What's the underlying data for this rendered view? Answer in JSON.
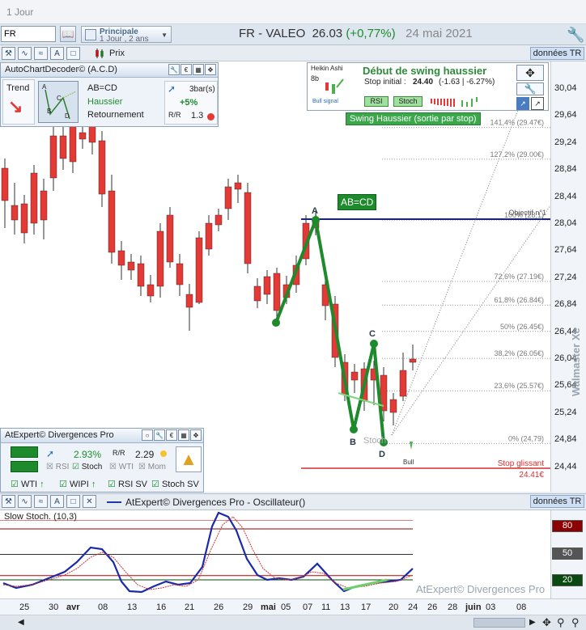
{
  "window": {
    "title": "1 Jour"
  },
  "toolbar": {
    "symbol_value": "FR",
    "layout_name": "Principale",
    "layout_period": "1 Jour , 2 ans",
    "instrument_title": "FR - VALEO",
    "price": "26.03",
    "change": "(+0,77%)",
    "date": "24 mai 2021",
    "prix_label": "Prix",
    "data_source": "données TR"
  },
  "acd": {
    "title": "AutoChartDecoder© (A.C.D)",
    "trend_label": "Trend",
    "pattern": "AB=CD",
    "direction": "Haussier",
    "reversal": "Retournement",
    "bars_count": "3bar(s)",
    "pct": "+5%",
    "ratio": "1.3",
    "mini_labels": [
      "A",
      "C",
      "B",
      "D"
    ]
  },
  "swing": {
    "heikin_label": "Heikin Ashi",
    "heikin_value": "8b",
    "bull_signal": "Bull signal",
    "title": "Début de swing haussier",
    "stop_label": "Stop initial :",
    "stop_value": "24.40",
    "stop_detail": "(-1.63 | -6.27%)",
    "rsi_btn": "RSI",
    "stoch_btn": "Stoch",
    "banner": "Swing Haussier (sortie par stop)"
  },
  "chart_overlay": {
    "abcd_tag": "AB=CD",
    "points": {
      "A": "A",
      "B": "B",
      "C": "C",
      "D": "D"
    },
    "objective_label": "Objectif n°1",
    "stoch_label": "Stoch",
    "bull_label": "Bull",
    "stop_label": "Stop glissant",
    "stop_value": "24.41€"
  },
  "fib_levels": [
    {
      "label": "141,4% (29.47€)",
      "price": 29.47
    },
    {
      "label": "127,2% (29.00€)",
      "price": 29.0
    },
    {
      "label": "100% (28,1)",
      "price": 28.1
    },
    {
      "label": "72,6% (27.19€)",
      "price": 27.19
    },
    {
      "label": "61,8% (26.84€)",
      "price": 26.84
    },
    {
      "label": "50% (26.45€)",
      "price": 26.45
    },
    {
      "label": "38,2% (26.05€)",
      "price": 26.05
    },
    {
      "label": "23,6% (25.57€)",
      "price": 25.57
    },
    {
      "label": "0% (24,79)",
      "price": 24.79
    }
  ],
  "y_axis": [
    "30,04",
    "29,64",
    "29,24",
    "28,84",
    "28,44",
    "28,04",
    "27,64",
    "27,24",
    "26,84",
    "26,44",
    "26,04",
    "25,64",
    "25,24",
    "24,84",
    "24,44"
  ],
  "divergences": {
    "title": "AtExpert© Divergences Pro",
    "val1": "2.93%",
    "val2": "2.29",
    "chk_rsi": "RSI",
    "chk_stoch": "Stoch",
    "chk_wti": "WTI",
    "chk_mom": "Mom",
    "chk_wti2": "WTI",
    "chk_wipi": "WIPI",
    "chk_rsisv": "RSI SV",
    "chk_stochsv": "Stoch SV"
  },
  "oscillator": {
    "title": "AtExpert© Divergences Pro - Oscillateur()",
    "indicator": "Slow Stoch. (10,3)",
    "watermark": "AtExpert© Divergences Pro",
    "levels": [
      "80",
      "50",
      "20"
    ],
    "data_source": "données TR"
  },
  "brand_watermark": "Walmaster Xe",
  "x_axis": [
    "25",
    "30",
    "avr",
    "08",
    "13",
    "16",
    "21",
    "26",
    "29",
    "mai",
    "05",
    "07",
    "11",
    "13",
    "17",
    "20",
    "24",
    "26",
    "28",
    "juin",
    "03",
    "08"
  ],
  "colors": {
    "up": "#4caf50",
    "down": "#e53935",
    "abcd": "#1d8a2c",
    "objective": "#1a237e",
    "stop": "#d32f2f"
  }
}
